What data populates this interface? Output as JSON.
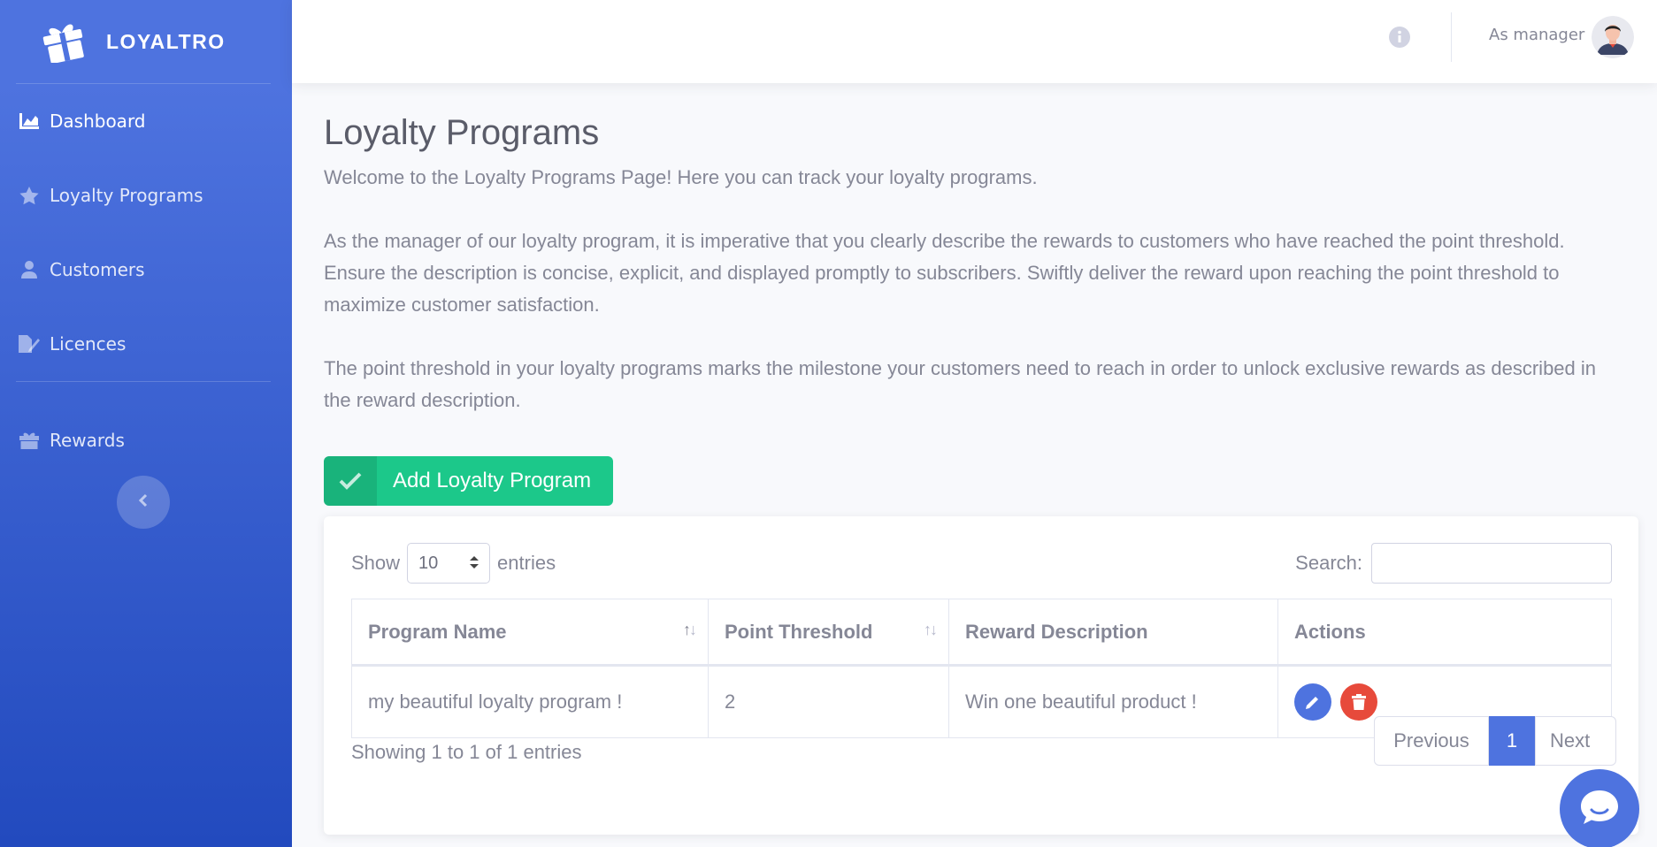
{
  "brand": {
    "name": "LOYALTRO"
  },
  "sidebar": {
    "items": [
      {
        "label": "Dashboard",
        "icon": "chart-area-icon"
      },
      {
        "label": "Loyalty Programs",
        "icon": "star-icon"
      },
      {
        "label": "Customers",
        "icon": "user-icon"
      },
      {
        "label": "Licences",
        "icon": "file-signature-icon"
      },
      {
        "label": "Rewards",
        "icon": "gift-icon"
      }
    ]
  },
  "topbar": {
    "user_label": "As manager"
  },
  "page": {
    "title": "Loyalty Programs",
    "intro": "Welcome to the Loyalty Programs Page! Here you can track your loyalty programs.",
    "para2": "As the manager of our loyalty program, it is imperative that you clearly describe the rewards to customers who have reached the point threshold. Ensure the description is concise, explicit, and displayed promptly to subscribers. Swiftly deliver the reward upon reaching the point threshold to maximize customer satisfaction.",
    "para3": "The point threshold in your loyalty programs marks the milestone your customers need to reach in order to unlock exclusive rewards as described in the reward description.",
    "add_button": "Add Loyalty Program"
  },
  "table": {
    "show_label": "Show",
    "entries_label": "entries",
    "page_size": "10",
    "search_label": "Search:",
    "columns": [
      "Program Name",
      "Point Threshold",
      "Reward Description",
      "Actions"
    ],
    "rows": [
      [
        "my beautiful loyalty program !",
        "2",
        "Win one beautiful product !"
      ]
    ],
    "info": "Showing 1 to 1 of 1 entries",
    "pagination": {
      "prev": "Previous",
      "current": "1",
      "next": "Next"
    }
  },
  "colors": {
    "primary": "#4e73df",
    "success": "#1cc88a",
    "danger": "#e74a3b"
  }
}
